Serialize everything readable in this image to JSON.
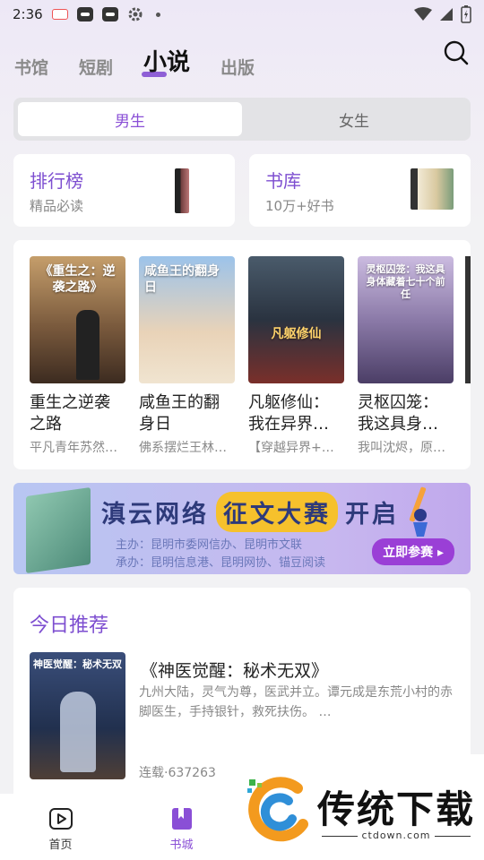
{
  "status_bar": {
    "time": "2:36"
  },
  "top_nav": {
    "tabs": [
      {
        "label": "书馆",
        "active": false
      },
      {
        "label": "短剧",
        "active": false
      },
      {
        "label": "小说",
        "active": true
      },
      {
        "label": "出版",
        "active": false
      }
    ]
  },
  "gender_toggle": {
    "options": [
      {
        "label": "男生",
        "active": true
      },
      {
        "label": "女生",
        "active": false
      }
    ]
  },
  "feature_cards": {
    "ranking": {
      "title": "排行榜",
      "subtitle": "精品必读"
    },
    "library": {
      "title": "书库",
      "subtitle": "10万+好书"
    }
  },
  "book_carousel": {
    "books": [
      {
        "title": "重生之逆袭之路",
        "desc": "平凡青年苏然…",
        "cover_text": "《重生之：逆袭之路》",
        "cover_color": "#8a6a4a"
      },
      {
        "title": "咸鱼王的翻身日",
        "desc": "佛系摆烂王林…",
        "cover_text": "咸鱼王的翻身日",
        "cover_color": "#8fb6e4"
      },
      {
        "title": "凡躯修仙：我在异界…",
        "desc": "【穿越异界+…",
        "cover_text": "凡躯修仙",
        "cover_color": "#2f3d4f"
      },
      {
        "title": "灵枢囚笼：我这具身…",
        "desc": "我叫沈烬，原…",
        "cover_text": "灵枢囚笼：我这具身体藏着七十个前任",
        "cover_color": "#6b5a8c"
      }
    ]
  },
  "banner": {
    "title_left": "滇云网络",
    "title_highlight": "征文大赛",
    "title_right": "开启",
    "organizer": "主办：昆明市委网信办、昆明市文联",
    "undertaker": "承办：昆明信息港、昆明网协、锚豆阅读",
    "cta": "立即参赛 ▸"
  },
  "today_recommend": {
    "heading": "今日推荐",
    "title": "《神医觉醒：秘术无双》",
    "desc": "九州大陆，灵气为尊，医武并立。谭元成是东荒小村的赤脚医生，手持银针，救死扶伤。 …",
    "meta": "连载·637263",
    "cover_text": "神医觉醒：秘术无双"
  },
  "bottom_nav": {
    "items": [
      {
        "label": "首页",
        "active": false
      },
      {
        "label": "书城",
        "active": true
      }
    ]
  },
  "watermark": {
    "text": "传统下载",
    "url": "ctdown.com"
  },
  "colors": {
    "accent": "#8a4fd6",
    "banner_highlight": "#f6c12c"
  }
}
